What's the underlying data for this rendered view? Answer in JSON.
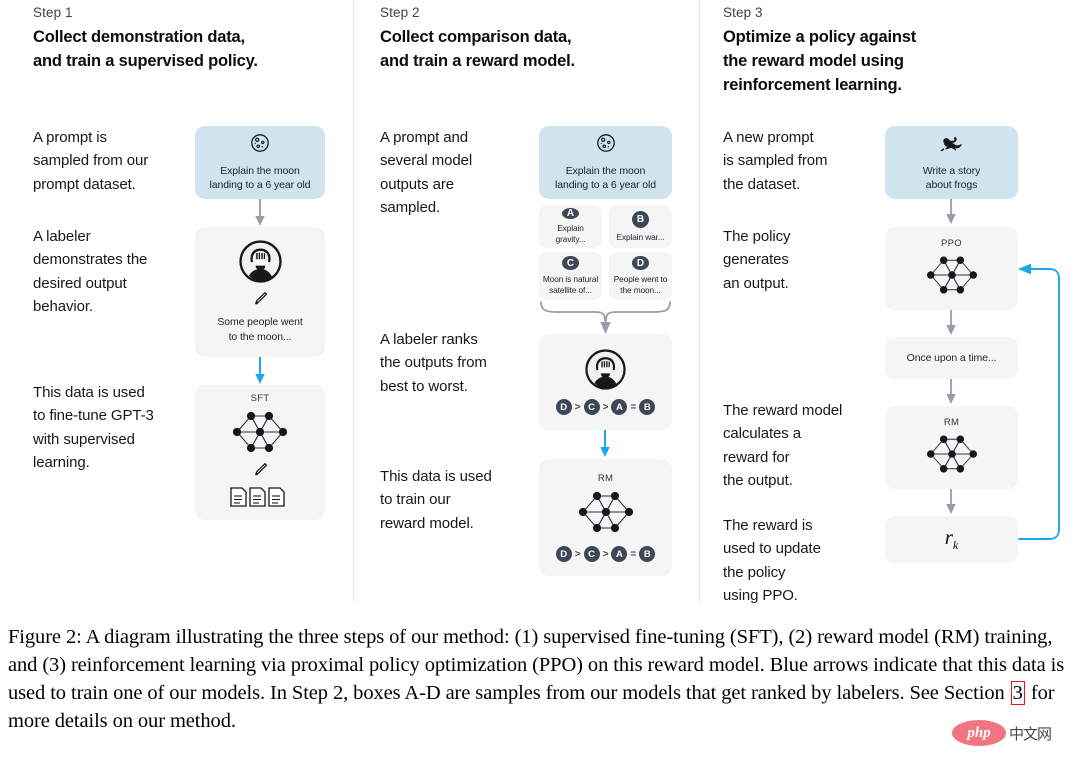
{
  "figure": {
    "caption_pre": "Figure 2: A diagram illustrating the three steps of our method: (1) supervised fine-tuning (SFT), (2) reward model (RM) training, and (3) reinforcement learning via proximal policy optimization (PPO) on this reward model. Blue arrows indicate that this data is used to train one of our models. In Step 2, boxes A-D are samples from our models that get ranked by labelers. See Section",
    "caption_link": "3",
    "caption_post": "for more details on our method."
  },
  "colors": {
    "prompt_box_blue": "#cfe4ef",
    "neutral_box_gray": "#f5f5f5",
    "train_arrow_blue": "#1aa7f0",
    "flow_arrow_gray": "#9a9aa8",
    "badge_navy": "#3f4757",
    "divider_gray": "#e8e8e8",
    "section_link_red": "#e8121a"
  },
  "steps": [
    {
      "label": "Step 1",
      "title": "Collect demonstration data,\nand train a supervised policy.",
      "descriptions": [
        "A prompt is\nsampled from our\nprompt dataset.",
        "A labeler\ndemonstrates the\ndesired output\nbehavior.",
        "This data is used\nto fine-tune GPT-3\nwith supervised\nlearning."
      ],
      "nodes": [
        {
          "name": "prompt-box",
          "icon": "moon-icon",
          "text": "Explain the moon\nlanding to a 6 year old",
          "style": "blue"
        },
        {
          "name": "labeler-box",
          "icon": "labeler-person-icon",
          "secondary_icon": "pencil-icon",
          "text": "Some people went\nto the moon...",
          "style": "gray"
        },
        {
          "name": "sft-model-box",
          "caption": "SFT",
          "icon": "neural-network-icon",
          "secondary_icon": "pencil-icon",
          "tertiary_icon": "documents-icon",
          "style": "gray"
        }
      ]
    },
    {
      "label": "Step 2",
      "title": "Collect comparison data,\nand train a reward model.",
      "descriptions": [
        "A prompt and\nseveral model\noutputs are\nsampled.",
        "A labeler ranks\nthe outputs from\nbest to worst.",
        "This data is used\nto train our\nreward model."
      ],
      "prompt": {
        "icon": "moon-icon",
        "text": "Explain the moon\nlanding to a 6 year old"
      },
      "samples": [
        {
          "badge": "A",
          "text": "Explain gravity..."
        },
        {
          "badge": "B",
          "text": "Explain war..."
        },
        {
          "badge": "C",
          "text": "Moon is natural\nsatellite of..."
        },
        {
          "badge": "D",
          "text": "People went to\nthe moon..."
        }
      ],
      "ranking": [
        "D",
        ">",
        "C",
        ">",
        "A",
        "=",
        "B"
      ],
      "rm_caption": "RM"
    },
    {
      "label": "Step 3",
      "title": "Optimize a policy against\nthe reward model using\nreinforcement learning.",
      "descriptions": [
        "A new prompt\nis sampled from\nthe dataset.",
        "The policy\ngenerates\nan output.",
        "The reward model\ncalculates a\nreward for\nthe output.",
        "The reward is\nused to update\nthe policy\nusing PPO."
      ],
      "nodes": [
        {
          "name": "new-prompt-box",
          "icon": "frog-icon",
          "text": "Write a story\nabout frogs",
          "style": "blue"
        },
        {
          "name": "ppo-policy-box",
          "caption": "PPO",
          "icon": "neural-network-icon",
          "style": "gray"
        },
        {
          "name": "generated-output-box",
          "text": "Once upon a time...",
          "style": "gray"
        },
        {
          "name": "reward-model-box",
          "caption": "RM",
          "icon": "neural-network-icon",
          "style": "gray"
        },
        {
          "name": "reward-value-box",
          "value": "r",
          "subscript": "k",
          "style": "gray"
        }
      ]
    }
  ],
  "watermark": {
    "logo_text": "php",
    "cn_text": "中文网"
  }
}
